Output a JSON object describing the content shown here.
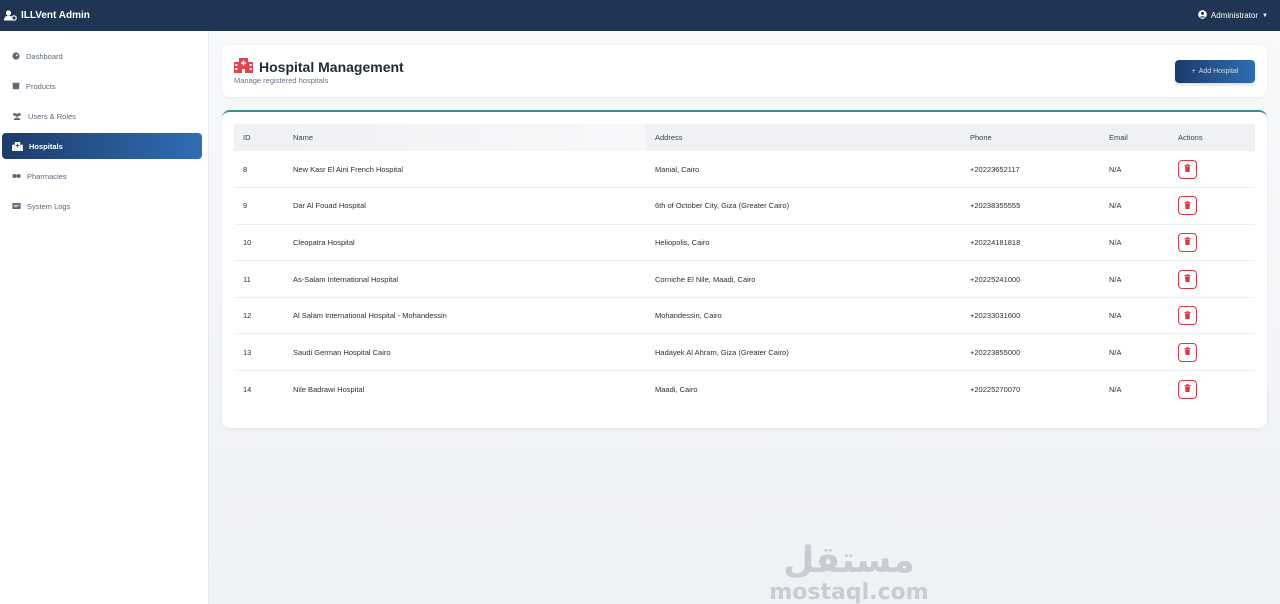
{
  "app": {
    "title": "ILLVent Admin",
    "user_label": "Administrator"
  },
  "sidebar": {
    "items": [
      {
        "label": "Dashboard",
        "icon": "dashboard-icon",
        "active": false
      },
      {
        "label": "Products",
        "icon": "box-icon",
        "active": false
      },
      {
        "label": "Users & Roles",
        "icon": "users-icon",
        "active": false
      },
      {
        "label": "Hospitals",
        "icon": "hospital-icon",
        "active": true
      },
      {
        "label": "Pharmacies",
        "icon": "pills-icon",
        "active": false
      },
      {
        "label": "System Logs",
        "icon": "logs-icon",
        "active": false
      }
    ]
  },
  "header": {
    "title": "Hospital Management",
    "subtitle": "Manage registered hospitals",
    "add_button_label": "Add Hospital"
  },
  "table": {
    "columns": [
      "ID",
      "Name",
      "Address",
      "Phone",
      "Email",
      "Actions"
    ],
    "rows": [
      {
        "id": "8",
        "name": "New Kasr El Aini French Hospital",
        "address": "Manial, Cairo",
        "phone": "+20223652117",
        "email": "N/A"
      },
      {
        "id": "9",
        "name": "Dar Al Fouad Hospital",
        "address": "6th of October City, Giza (Greater Cairo)",
        "phone": "+20238355555",
        "email": "N/A"
      },
      {
        "id": "10",
        "name": "Cleopatra Hospital",
        "address": "Heliopolis, Cairo",
        "phone": "+20224181818",
        "email": "N/A"
      },
      {
        "id": "11",
        "name": "As-Salam International Hospital",
        "address": "Corniche El Nile, Maadi, Cairo",
        "phone": "+20225241000",
        "email": "N/A"
      },
      {
        "id": "12",
        "name": "Al Salam International Hospital - Mohandessin",
        "address": "Mohandessin, Cairo",
        "phone": "+20233031600",
        "email": "N/A"
      },
      {
        "id": "13",
        "name": "Saudi German Hospital Cairo",
        "address": "Hadayek Al Ahram, Giza (Greater Cairo)",
        "phone": "+20223855000",
        "email": "N/A"
      },
      {
        "id": "14",
        "name": "Nile Badrawi Hospital",
        "address": "Maadi, Cairo",
        "phone": "+20225270070",
        "email": "N/A"
      }
    ]
  },
  "watermark": {
    "arabic": "مستقل",
    "latin": "mostaql.com"
  },
  "colors": {
    "topbar": "#1f3553",
    "accent": "#2f6db3",
    "danger": "#d33a46",
    "hospital_icon": "#e0444f"
  }
}
